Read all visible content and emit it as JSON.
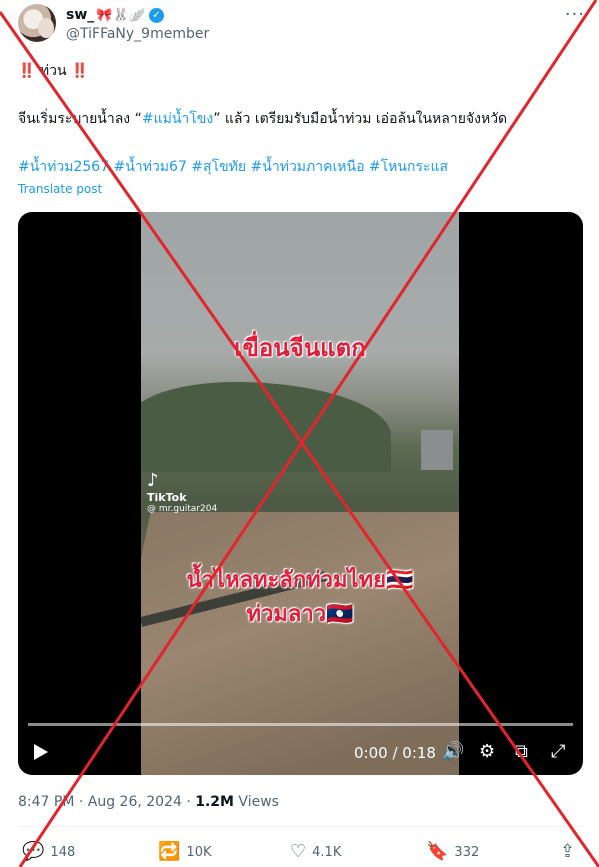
{
  "header": {
    "name": "sw_",
    "name_emojis": "🎀🐰🪽",
    "handle": "@TiFFaNy_9member",
    "more_label": "···"
  },
  "post": {
    "line1_bang_left": "‼️",
    "line1_text": "ท่วน",
    "line1_bang_right": "‼️",
    "line2_before": "จีนเริ่มระบายน้ำลง “",
    "line2_hashtag": "#แม่น้ำโขง",
    "line2_after": "” แล้ว เตรียมรับมือน้ำท่วม เอ่อล้นในหลายจังหวัด",
    "hashtags": "#น้ำท่วม2567 #น้ำท่วม67 #สุโขทัย #น้ำท่วมภาคเหนือ #โหนกระแส",
    "translate": "Translate post"
  },
  "video": {
    "overlay_top": "เขื่อนจีนแตก",
    "overlay_mid": "น้ำไหลทะลักท่วมไทย🇹🇭",
    "overlay_bottom": "ท่วมลาว🇱🇦",
    "tiktok_brand": "TikTok",
    "tiktok_user": "@ mr.guitar204",
    "time": "0:00 / 0:18",
    "progress": 0
  },
  "meta": {
    "time": "8:47 PM · Aug 26, 2024 · ",
    "views_count": "1.2M",
    "views_label": " Views"
  },
  "actions": {
    "replies": "148",
    "reposts": "10K",
    "likes": "4.1K",
    "bookmarks": "332"
  },
  "colors": {
    "accent": "#1d9bf0",
    "overlay_red": "#e11d3c",
    "cross_red": "#e3242b"
  }
}
